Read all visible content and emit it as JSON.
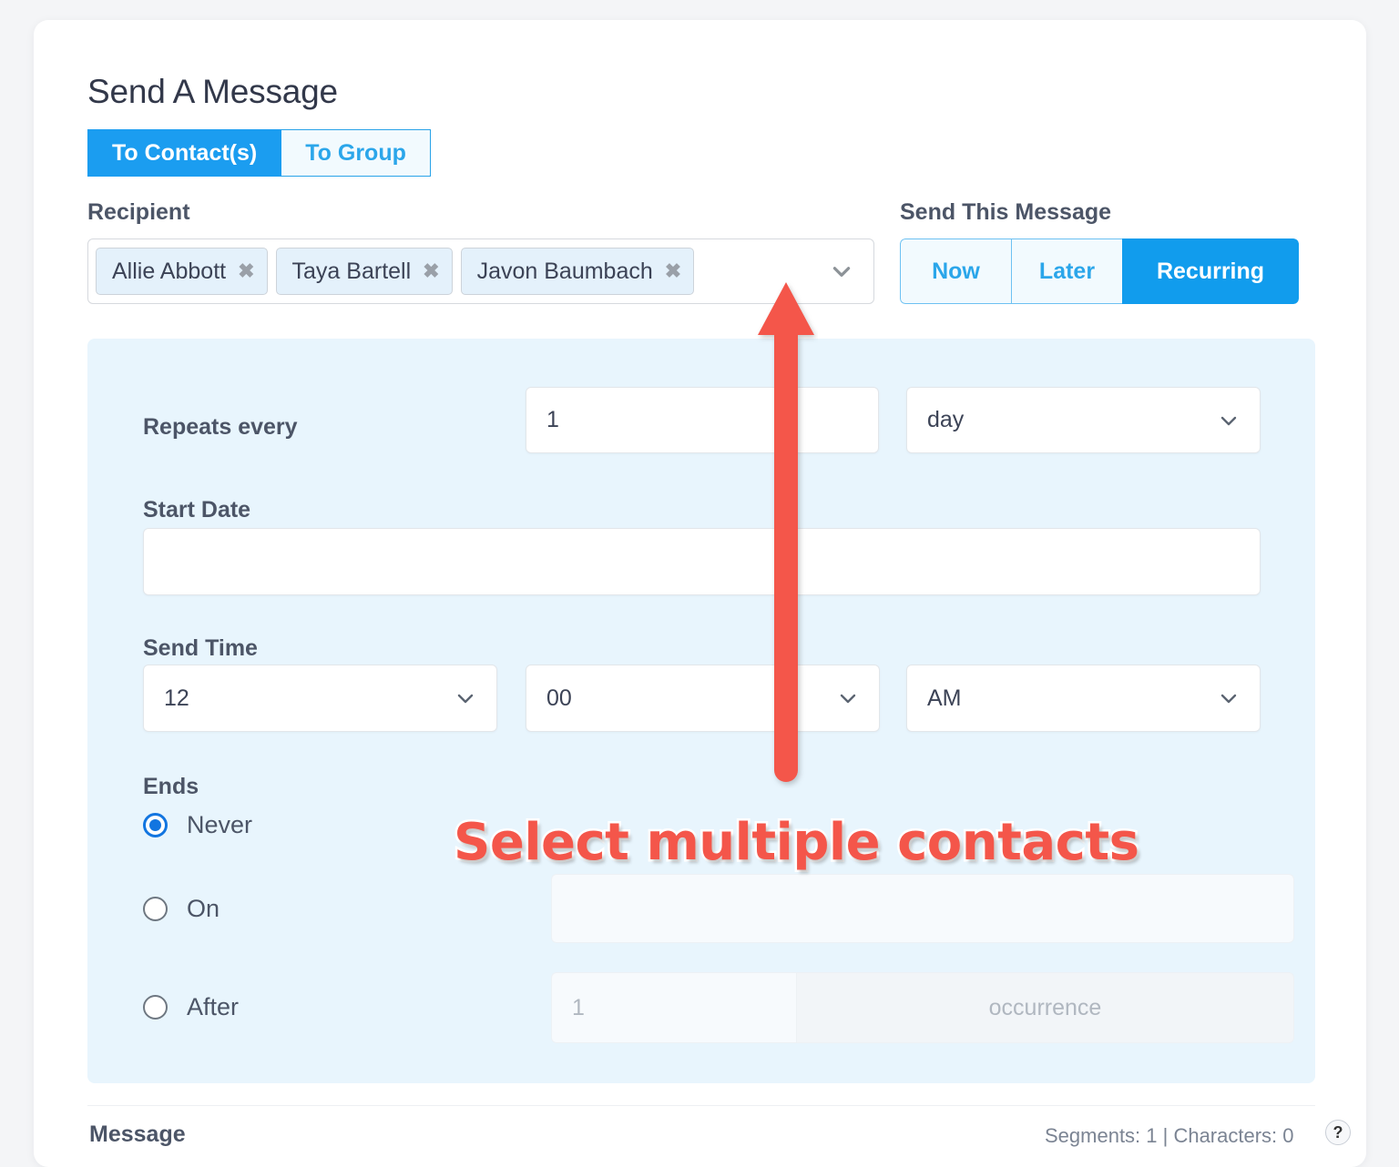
{
  "page": {
    "title": "Send A Message"
  },
  "audience_toggle": {
    "options": [
      {
        "label": "To Contact(s)",
        "active": true
      },
      {
        "label": "To Group",
        "active": false
      }
    ]
  },
  "recipient": {
    "label": "Recipient",
    "chips": [
      {
        "name": "Allie Abbott",
        "remove": "✖"
      },
      {
        "name": "Taya Bartell",
        "remove": "✖"
      },
      {
        "name": "Javon Baumbach",
        "remove": "✖"
      }
    ],
    "caret_icon": "chevron-down-icon"
  },
  "schedule": {
    "label": "Send This Message",
    "options": [
      {
        "label": "Now",
        "active": false
      },
      {
        "label": "Later",
        "active": false
      },
      {
        "label": "Recurring",
        "active": true
      }
    ]
  },
  "recurring": {
    "repeats": {
      "label": "Repeats every",
      "count_value": "1",
      "unit_value": "day",
      "unit_caret": "chevron-down-icon"
    },
    "start_date": {
      "label": "Start Date",
      "value": ""
    },
    "send_time": {
      "label": "Send Time",
      "hour": "12",
      "minute": "00",
      "meridiem": "AM"
    },
    "ends": {
      "label": "Ends",
      "options": [
        {
          "label": "Never",
          "selected": true
        },
        {
          "label": "On",
          "selected": false
        },
        {
          "label": "After",
          "selected": false
        }
      ],
      "on_value": "",
      "after_count": "1",
      "after_unit": "occurrence"
    }
  },
  "footer": {
    "message_label": "Message",
    "counter": "Segments: 1 | Characters: 0",
    "help_glyph": "?"
  },
  "annotation": {
    "text": "Select multiple contacts",
    "color": "#f4564a",
    "arrow": "up-arrow-icon"
  },
  "colors": {
    "accent_blue": "#119ced",
    "panel_blue": "#e8f5fd",
    "chip_blue": "#e4f1fb",
    "text_dark": "#4c5567",
    "annotation_red": "#f4564a"
  }
}
